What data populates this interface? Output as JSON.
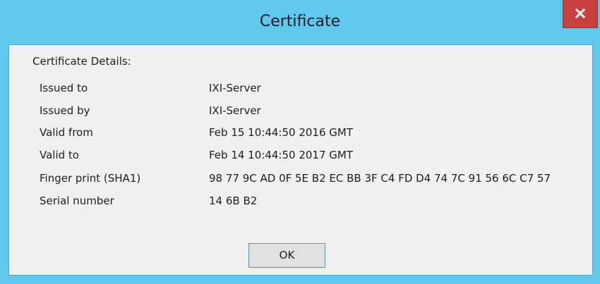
{
  "window": {
    "title": "Certificate",
    "close_icon": "close-x-icon"
  },
  "details": {
    "heading": "Certificate Details:",
    "rows": [
      {
        "label": "Issued to",
        "value": "IXI-Server"
      },
      {
        "label": "Issued by",
        "value": "IXI-Server"
      },
      {
        "label": "Valid from",
        "value": "Feb 15 10:44:50 2016 GMT"
      },
      {
        "label": "Valid to",
        "value": "Feb 14 10:44:50 2017 GMT"
      },
      {
        "label": "Finger print (SHA1)",
        "value": "98 77 9C AD 0F 5E B2 EC BB 3F C4 FD D4 74 7C 91 56 6C C7 57"
      },
      {
        "label": "Serial number",
        "value": "14 6B B2"
      }
    ]
  },
  "buttons": {
    "ok_label": "OK"
  },
  "colors": {
    "titlebar": "#5ec8ef",
    "close_button": "#c8413e",
    "client_background": "#f0f0f0",
    "button_border": "#3c9cd6"
  }
}
